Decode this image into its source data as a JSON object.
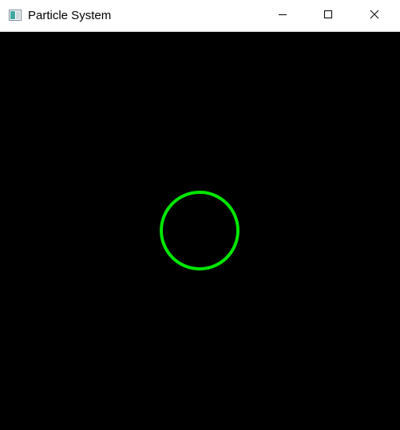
{
  "window": {
    "title": "Particle System",
    "app_icon": "app-window-icon",
    "controls": {
      "minimize_icon": "minimize-icon",
      "maximize_icon": "maximize-icon",
      "close_icon": "close-icon"
    }
  },
  "canvas": {
    "background_color": "#000000",
    "particle_color": "#00e600",
    "particle_shape": "ring"
  }
}
